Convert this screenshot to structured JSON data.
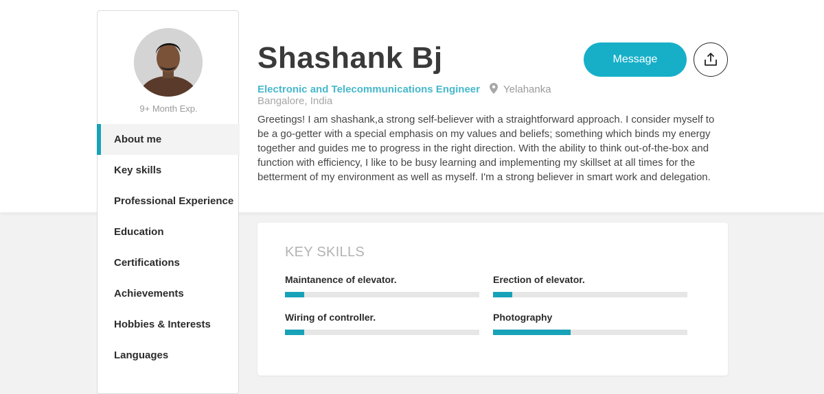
{
  "profile": {
    "experience": "9+ Month Exp.",
    "name": "Shashank Bj",
    "role": "Electronic and Telecommunications Engineer",
    "city": "Yelahanka",
    "country": "Bangalore, India",
    "bio": "Greetings! I am shashank,a strong self-believer with a straightforward approach. I consider myself to be a go-getter with a special emphasis on my values and beliefs; something which binds my energy together and guides me to progress in the right direction. With the ability to think out-of-the-box and function with efficiency, I like to be busy learning and implementing my skillset at all times for the betterment of my environment as well as myself. I'm a strong believer in smart work and delegation."
  },
  "actions": {
    "message_label": "Message",
    "share_icon": "share-icon"
  },
  "sidebar": {
    "items": [
      {
        "label": "About me",
        "active": true
      },
      {
        "label": "Key skills"
      },
      {
        "label": "Professional Experience"
      },
      {
        "label": "Education"
      },
      {
        "label": "Certifications"
      },
      {
        "label": "Achievements"
      },
      {
        "label": "Hobbies & Interests"
      },
      {
        "label": "Languages"
      }
    ]
  },
  "skills_section": {
    "title": "KEY SKILLS",
    "skills": [
      {
        "name": "Maintanence of elevator.",
        "level": 0.1
      },
      {
        "name": "Erection of elevator.",
        "level": 0.1
      },
      {
        "name": "Wiring of controller.",
        "level": 0.1
      },
      {
        "name": "Photography",
        "level": 0.4
      }
    ]
  },
  "colors": {
    "accent": "#17a2b8",
    "button": "#17afc8",
    "role_text": "#45b8cc"
  }
}
